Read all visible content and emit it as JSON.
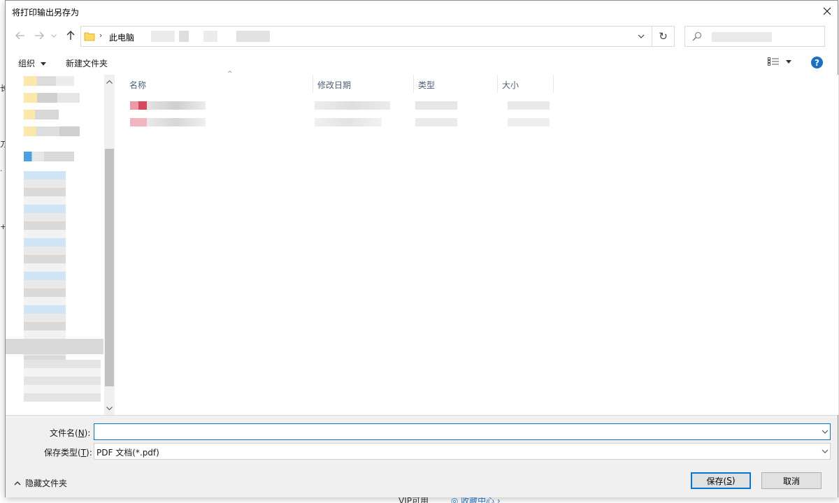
{
  "dialog": {
    "title": "将打印输出另存为"
  },
  "address": {
    "root": "此电脑"
  },
  "toolbar": {
    "organize": "组织",
    "new_folder": "新建文件夹"
  },
  "columns": [
    {
      "label": "名称"
    },
    {
      "label": "修改日期"
    },
    {
      "label": "类型"
    },
    {
      "label": "大小"
    }
  ],
  "form": {
    "filename_label": "文件名(",
    "filename_key": "N",
    "filename_suffix": "):",
    "filename_value": "",
    "filetype_label": "保存类型(",
    "filetype_key": "T",
    "filetype_suffix": "):",
    "filetype_value": "PDF 文档(*.pdf)"
  },
  "footer": {
    "hide_folders": "隐藏文件夹",
    "save_label": "保存(",
    "save_key": "S",
    "save_suffix": ")",
    "cancel_label": "取消"
  },
  "background": {
    "edge_chars": [
      "长",
      "刀",
      "·",
      "+"
    ],
    "bottom_text": "VIP可用",
    "bottom_link": "◎ 收藏中心 ›"
  },
  "colors": {
    "accent": "#0078d7",
    "help_icon": "#1a6fc9",
    "column_header_text": "#4c607a",
    "folder_icon": "#ffd866"
  }
}
